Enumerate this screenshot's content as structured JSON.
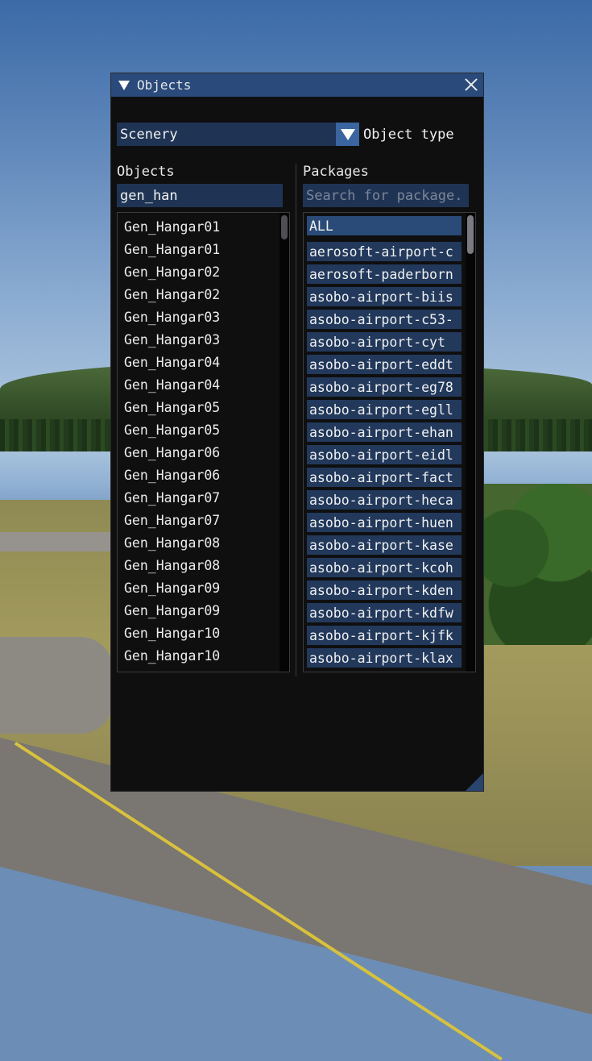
{
  "window": {
    "title": "Objects",
    "colors": {
      "titlebar": "#294a7a",
      "background": "#0f0f10",
      "field": "#1f3454",
      "accent": "#3a65a0"
    }
  },
  "object_type": {
    "selected": "Scenery",
    "label": "Object type"
  },
  "objects_panel": {
    "header": "Objects",
    "filter_value": "gen_han",
    "items": [
      "Gen_Hangar01",
      "Gen_Hangar01",
      "Gen_Hangar02",
      "Gen_Hangar02",
      "Gen_Hangar03",
      "Gen_Hangar03",
      "Gen_Hangar04",
      "Gen_Hangar04",
      "Gen_Hangar05",
      "Gen_Hangar05",
      "Gen_Hangar06",
      "Gen_Hangar06",
      "Gen_Hangar07",
      "Gen_Hangar07",
      "Gen_Hangar08",
      "Gen_Hangar08",
      "Gen_Hangar09",
      "Gen_Hangar09",
      "Gen_Hangar10",
      "Gen_Hangar10"
    ]
  },
  "packages_panel": {
    "header": "Packages",
    "search_placeholder": "Search for package.",
    "items": [
      "ALL",
      "aerosoft-airport-c",
      "aerosoft-paderborn",
      "asobo-airport-biis",
      "asobo-airport-c53-",
      "asobo-airport-cyt",
      "asobo-airport-eddt",
      "asobo-airport-eg78",
      "asobo-airport-egll",
      "asobo-airport-ehan",
      "asobo-airport-eidl",
      "asobo-airport-fact",
      "asobo-airport-heca",
      "asobo-airport-huen",
      "asobo-airport-kase",
      "asobo-airport-kcoh",
      "asobo-airport-kden",
      "asobo-airport-kdfw",
      "asobo-airport-kjfk",
      "asobo-airport-klax"
    ]
  }
}
